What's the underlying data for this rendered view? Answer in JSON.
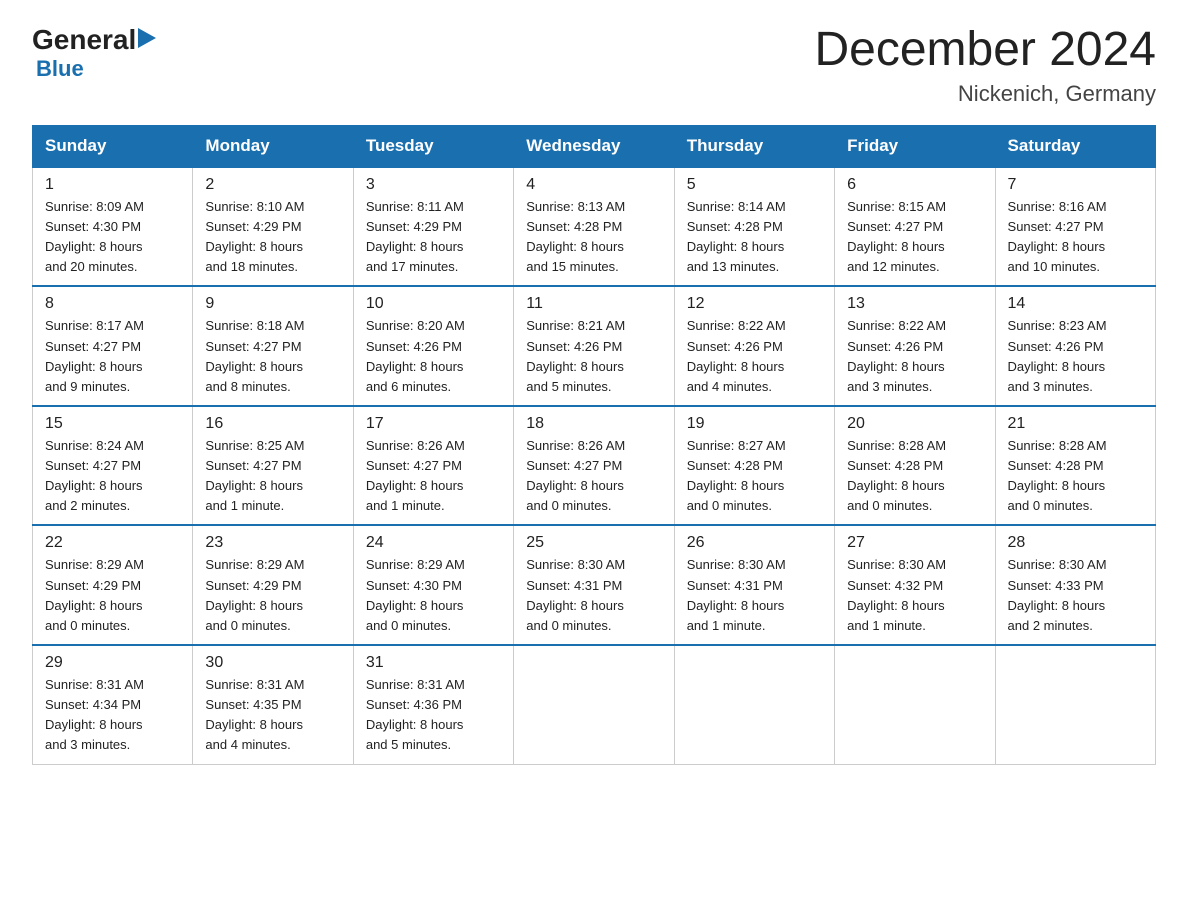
{
  "header": {
    "logo_general": "General",
    "logo_triangle": "▶",
    "logo_blue": "Blue",
    "title": "December 2024",
    "subtitle": "Nickenich, Germany"
  },
  "days_of_week": [
    "Sunday",
    "Monday",
    "Tuesday",
    "Wednesday",
    "Thursday",
    "Friday",
    "Saturday"
  ],
  "weeks": [
    [
      {
        "num": "1",
        "info": "Sunrise: 8:09 AM\nSunset: 4:30 PM\nDaylight: 8 hours\nand 20 minutes."
      },
      {
        "num": "2",
        "info": "Sunrise: 8:10 AM\nSunset: 4:29 PM\nDaylight: 8 hours\nand 18 minutes."
      },
      {
        "num": "3",
        "info": "Sunrise: 8:11 AM\nSunset: 4:29 PM\nDaylight: 8 hours\nand 17 minutes."
      },
      {
        "num": "4",
        "info": "Sunrise: 8:13 AM\nSunset: 4:28 PM\nDaylight: 8 hours\nand 15 minutes."
      },
      {
        "num": "5",
        "info": "Sunrise: 8:14 AM\nSunset: 4:28 PM\nDaylight: 8 hours\nand 13 minutes."
      },
      {
        "num": "6",
        "info": "Sunrise: 8:15 AM\nSunset: 4:27 PM\nDaylight: 8 hours\nand 12 minutes."
      },
      {
        "num": "7",
        "info": "Sunrise: 8:16 AM\nSunset: 4:27 PM\nDaylight: 8 hours\nand 10 minutes."
      }
    ],
    [
      {
        "num": "8",
        "info": "Sunrise: 8:17 AM\nSunset: 4:27 PM\nDaylight: 8 hours\nand 9 minutes."
      },
      {
        "num": "9",
        "info": "Sunrise: 8:18 AM\nSunset: 4:27 PM\nDaylight: 8 hours\nand 8 minutes."
      },
      {
        "num": "10",
        "info": "Sunrise: 8:20 AM\nSunset: 4:26 PM\nDaylight: 8 hours\nand 6 minutes."
      },
      {
        "num": "11",
        "info": "Sunrise: 8:21 AM\nSunset: 4:26 PM\nDaylight: 8 hours\nand 5 minutes."
      },
      {
        "num": "12",
        "info": "Sunrise: 8:22 AM\nSunset: 4:26 PM\nDaylight: 8 hours\nand 4 minutes."
      },
      {
        "num": "13",
        "info": "Sunrise: 8:22 AM\nSunset: 4:26 PM\nDaylight: 8 hours\nand 3 minutes."
      },
      {
        "num": "14",
        "info": "Sunrise: 8:23 AM\nSunset: 4:26 PM\nDaylight: 8 hours\nand 3 minutes."
      }
    ],
    [
      {
        "num": "15",
        "info": "Sunrise: 8:24 AM\nSunset: 4:27 PM\nDaylight: 8 hours\nand 2 minutes."
      },
      {
        "num": "16",
        "info": "Sunrise: 8:25 AM\nSunset: 4:27 PM\nDaylight: 8 hours\nand 1 minute."
      },
      {
        "num": "17",
        "info": "Sunrise: 8:26 AM\nSunset: 4:27 PM\nDaylight: 8 hours\nand 1 minute."
      },
      {
        "num": "18",
        "info": "Sunrise: 8:26 AM\nSunset: 4:27 PM\nDaylight: 8 hours\nand 0 minutes."
      },
      {
        "num": "19",
        "info": "Sunrise: 8:27 AM\nSunset: 4:28 PM\nDaylight: 8 hours\nand 0 minutes."
      },
      {
        "num": "20",
        "info": "Sunrise: 8:28 AM\nSunset: 4:28 PM\nDaylight: 8 hours\nand 0 minutes."
      },
      {
        "num": "21",
        "info": "Sunrise: 8:28 AM\nSunset: 4:28 PM\nDaylight: 8 hours\nand 0 minutes."
      }
    ],
    [
      {
        "num": "22",
        "info": "Sunrise: 8:29 AM\nSunset: 4:29 PM\nDaylight: 8 hours\nand 0 minutes."
      },
      {
        "num": "23",
        "info": "Sunrise: 8:29 AM\nSunset: 4:29 PM\nDaylight: 8 hours\nand 0 minutes."
      },
      {
        "num": "24",
        "info": "Sunrise: 8:29 AM\nSunset: 4:30 PM\nDaylight: 8 hours\nand 0 minutes."
      },
      {
        "num": "25",
        "info": "Sunrise: 8:30 AM\nSunset: 4:31 PM\nDaylight: 8 hours\nand 0 minutes."
      },
      {
        "num": "26",
        "info": "Sunrise: 8:30 AM\nSunset: 4:31 PM\nDaylight: 8 hours\nand 1 minute."
      },
      {
        "num": "27",
        "info": "Sunrise: 8:30 AM\nSunset: 4:32 PM\nDaylight: 8 hours\nand 1 minute."
      },
      {
        "num": "28",
        "info": "Sunrise: 8:30 AM\nSunset: 4:33 PM\nDaylight: 8 hours\nand 2 minutes."
      }
    ],
    [
      {
        "num": "29",
        "info": "Sunrise: 8:31 AM\nSunset: 4:34 PM\nDaylight: 8 hours\nand 3 minutes."
      },
      {
        "num": "30",
        "info": "Sunrise: 8:31 AM\nSunset: 4:35 PM\nDaylight: 8 hours\nand 4 minutes."
      },
      {
        "num": "31",
        "info": "Sunrise: 8:31 AM\nSunset: 4:36 PM\nDaylight: 8 hours\nand 5 minutes."
      },
      null,
      null,
      null,
      null
    ]
  ]
}
